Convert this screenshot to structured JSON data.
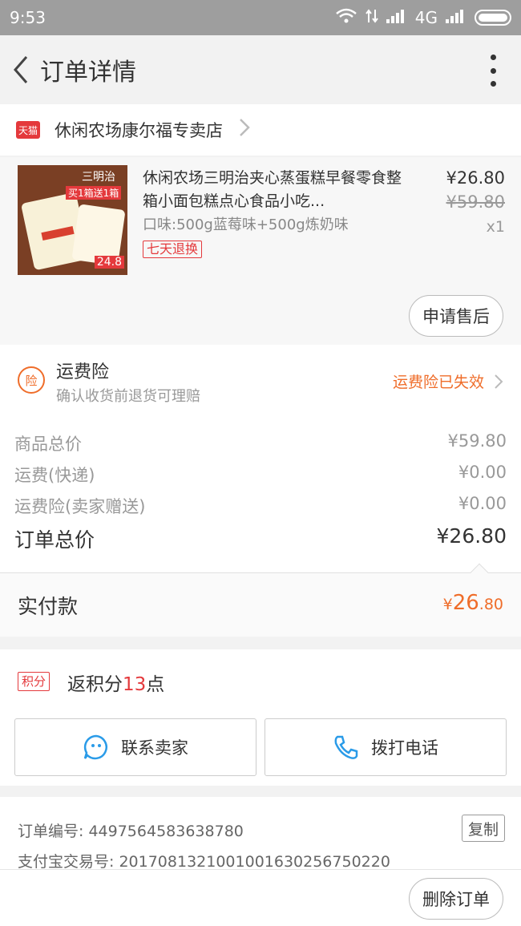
{
  "statusbar": {
    "time": "9:53",
    "network": "4G"
  },
  "appbar": {
    "title": "订单详情"
  },
  "shop": {
    "badge": "天猫",
    "name": "休闲农场康尔福专卖店"
  },
  "item": {
    "title": "休闲农场三明治夹心蒸蛋糕早餐零食整箱小面包糕点心食品小吃...",
    "spec": "口味:500g蓝莓味+500g炼奶味",
    "tag": "七天退换",
    "price": "¥26.80",
    "original_price": "¥59.80",
    "quantity": "x1",
    "thumb_text": {
      "brand": "三明治",
      "promo": "买1箱送1箱",
      "price": "24.8"
    },
    "after_sale_label": "申请售后"
  },
  "insurance": {
    "icon_label": "险",
    "title": "运费险",
    "subtitle": "确认收货前退货可理赔",
    "status": "运费险已失效"
  },
  "costs": {
    "goods_total_label": "商品总价",
    "goods_total": "¥59.80",
    "shipping_label": "运费(快递)",
    "shipping": "¥0.00",
    "ins_label": "运费险(卖家赠送)",
    "ins": "¥0.00",
    "order_total_label": "订单总价",
    "order_total": "¥26.80"
  },
  "paid": {
    "label": "实付款",
    "currency": "¥",
    "int": "26",
    "dec": ".80"
  },
  "points": {
    "tag": "积分",
    "prefix": "返积分",
    "count": "13",
    "suffix": "点"
  },
  "actions": {
    "contact_seller": "联系卖家",
    "call": "拨打电话"
  },
  "info": {
    "order_no_label": "订单编号: ",
    "order_no": "4497564583638780",
    "alipay_label": "支付宝交易号: ",
    "alipay_no": "2017081321001001630256750220",
    "copy_label": "复制"
  },
  "footer": {
    "delete_label": "删除订单"
  },
  "colors": {
    "accent": "#ef6d2a",
    "tmall_red": "#e4393c",
    "icon_blue": "#2a9be8"
  }
}
